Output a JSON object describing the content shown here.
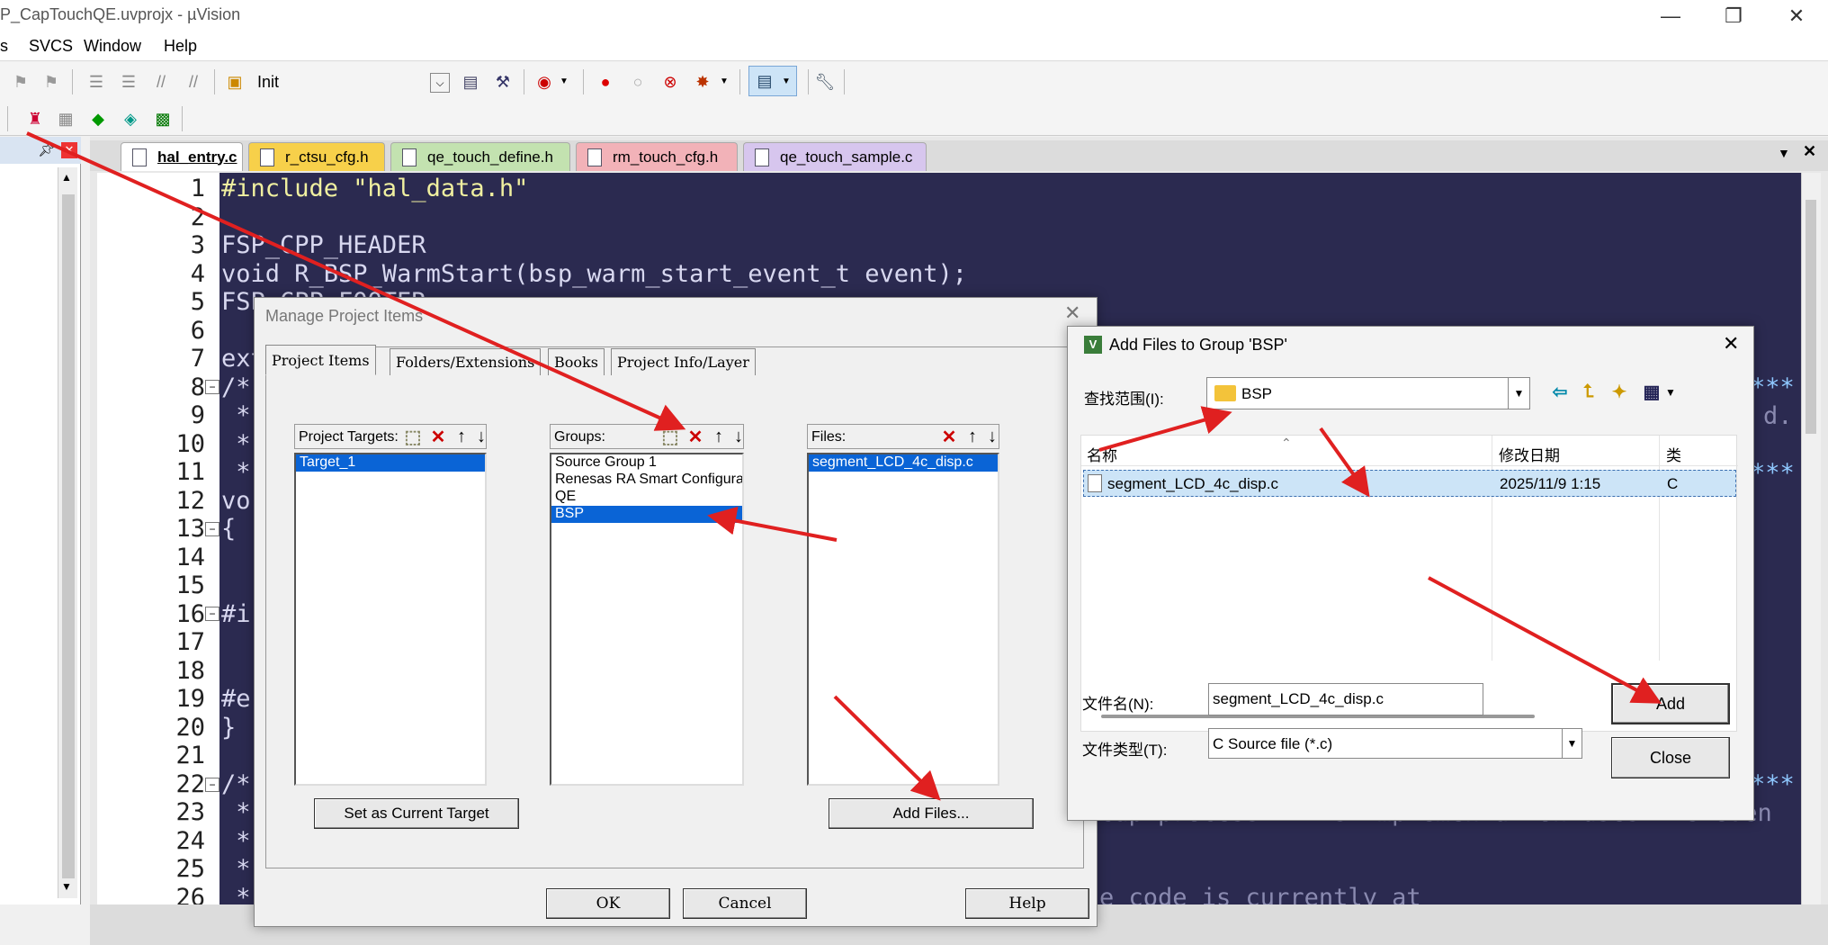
{
  "window": {
    "title": "P_CapTouchQE.uvprojx - µVision"
  },
  "menu": {
    "items": [
      "s",
      "SVCS",
      "Window",
      "Help"
    ]
  },
  "toolbar": {
    "target_select": "Init"
  },
  "tabs": [
    "hal_entry.c",
    "r_ctsu_cfg.h",
    "qe_touch_define.h",
    "rm_touch_cfg.h",
    "qe_touch_sample.c"
  ],
  "editor": {
    "line_numbers": [
      "1",
      "2",
      "3",
      "4",
      "5",
      "6",
      "7",
      "8",
      "9",
      "10",
      "11",
      "12",
      "13",
      "14",
      "15",
      "16",
      "17",
      "18",
      "19",
      "20",
      "21",
      "22",
      "23",
      "24",
      "25",
      "26"
    ],
    "lines": [
      "#include \"hal_data.h\"",
      "",
      "FSP_CPP_HEADER",
      "void R_BSP_WarmStart(bsp_warm_start_event_t event);",
      "FSP_CPP_FOOTER",
      "",
      "ext",
      "/*",
      " *",
      " *",
      " *",
      "vo",
      "{",
      "",
      "",
      "#i",
      "",
      "",
      "#e",
      "}",
      "",
      "/*",
      " *",
      " *",
      " *",
      " *"
    ],
    "right_fragments": {
      "r8": "***",
      "r9": "d.",
      "r11": "***",
      "r22": "***",
      "r23": "cap process. This implementation uses the even",
      "r26": "e code is currently at"
    }
  },
  "manage_dialog": {
    "title": "Manage Project Items",
    "tabs": [
      "Project Items",
      "Folders/Extensions",
      "Books",
      "Project Info/Layer"
    ],
    "targets_label": "Project Targets:",
    "targets": [
      "Target_1"
    ],
    "groups_label": "Groups:",
    "groups": [
      "Source Group 1",
      "Renesas RA Smart Configurator:Common Sources",
      "QE",
      "BSP"
    ],
    "files_label": "Files:",
    "files": [
      "segment_LCD_4c_disp.c"
    ],
    "set_target_button": "Set as Current Target",
    "add_files_button": "Add Files...",
    "ok_button": "OK",
    "cancel_button": "Cancel",
    "help_button": "Help"
  },
  "add_dialog": {
    "title": "Add Files to Group 'BSP'",
    "look_in_label": "查找范围(I):",
    "look_in_value": "BSP",
    "col_name": "名称",
    "col_date": "修改日期",
    "col_type": "类",
    "file_name": "segment_LCD_4c_disp.c",
    "file_date": "2025/11/9 1:15",
    "file_type": "C",
    "filename_label": "文件名(N):",
    "filename_value": "segment_LCD_4c_disp.c",
    "filetype_label": "文件类型(T):",
    "filetype_value": "C Source file (*.c)",
    "add_button": "Add",
    "close_button": "Close"
  }
}
